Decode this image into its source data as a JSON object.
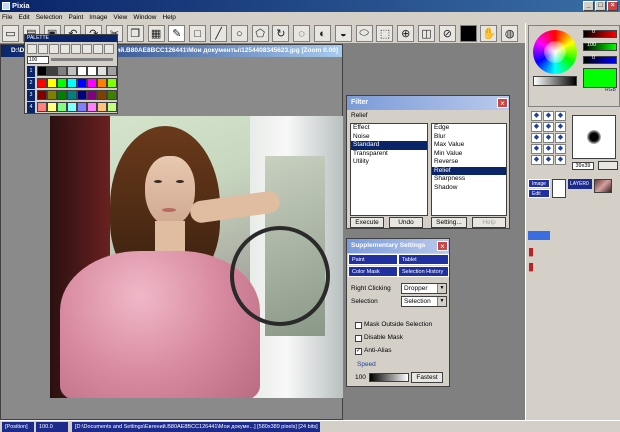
{
  "app": {
    "title": "Pixia"
  },
  "menu": [
    "File",
    "Edit",
    "Selection",
    "Paint",
    "Image",
    "View",
    "Window",
    "Help"
  ],
  "toolbar": {
    "icons": [
      "new-file-icon",
      "open-icon",
      "save-icon",
      "undo-icon",
      "redo-icon",
      "cut-icon",
      "copy-icon",
      "paste-icon",
      "pen-icon",
      "rectangle-icon",
      "line-icon",
      "circle-icon",
      "polygon-icon",
      "rotate-icon",
      "lasso-icon",
      "brush-icon",
      "fill-icon",
      "ellipse-icon",
      "select-icon",
      "magnify-icon",
      "mask-icon",
      "eyedropper-icon",
      "black-swatch-icon",
      "hand-icon",
      "zoom-icon"
    ]
  },
  "document": {
    "title": "D:\\Documents and Settings\\Евгений.B80AE8BCC126441\\Мои документы\\1254408345623.jpg [Zoom 0.00]",
    "photo_desc": "Woman in pink ruffled dress sitting in vintage car"
  },
  "palette": {
    "title": "PALETTE",
    "size_value": "100",
    "row_labels": [
      "1",
      "2",
      "3",
      "4"
    ],
    "colors": [
      "#000000",
      "#404040",
      "#808080",
      "#c0c0c0",
      "#ffffff",
      "#ffffff",
      "#e0e0e0",
      "#a0a0a0",
      "#ff0000",
      "#ffff00",
      "#00ff00",
      "#00ffff",
      "#0000ff",
      "#ff00ff",
      "#ff8000",
      "#80ff00",
      "#800000",
      "#808000",
      "#008000",
      "#008080",
      "#000080",
      "#800080",
      "#804000",
      "#408000",
      "#ff8080",
      "#ffff80",
      "#80ff80",
      "#80ffff",
      "#8080ff",
      "#ff80ff",
      "#ffc080",
      "#c0ff80"
    ]
  },
  "filter": {
    "title": "Filter",
    "current": "Relief",
    "categories": [
      "Effect",
      "Noise",
      "Standard",
      "Transparent",
      "Utility"
    ],
    "selected_category": "Standard",
    "items": [
      "Edge",
      "Blur",
      "Max Value",
      "Min Value",
      "Reverse",
      "Relief",
      "Sharpness",
      "Shadow"
    ],
    "selected_item": "Relief",
    "buttons": {
      "execute": "Execute",
      "undo": "Undo",
      "setting": "Setting...",
      "help": "Help"
    }
  },
  "supplementary": {
    "title": "Supplementary Settings",
    "tabs": [
      "Paint",
      "Tablet",
      "Color Mask",
      "Selection History"
    ],
    "right_clicking_label": "Right Clicking",
    "right_clicking_value": "Dropper",
    "selection_label": "Selection",
    "selection_value": "Selection",
    "mask_outside": "Mask Outside Selection",
    "disable_mask": "Disable Mask",
    "anti_alias": "Anti-Alias",
    "anti_alias_checked": true,
    "speed_label": "Speed",
    "speed_value": "100",
    "fastest": "Fastest"
  },
  "color_panel": {
    "r": "0",
    "g": "100",
    "b": "0",
    "preview_color": "#00ff00",
    "rgb_label": "RGB"
  },
  "brush_panel": {
    "size_label": "39x39"
  },
  "layer_panel": {
    "image_label": "Image",
    "edit_label": "Edit",
    "layer_label": "LAYER0"
  },
  "status": {
    "position": "[Position]",
    "zoom": "100.0",
    "path": "[D:\\Documents and Settings\\Евгений.B80AE8BCC126441\\Мои докуме...] [580x389 pixels] [24 bits]"
  }
}
